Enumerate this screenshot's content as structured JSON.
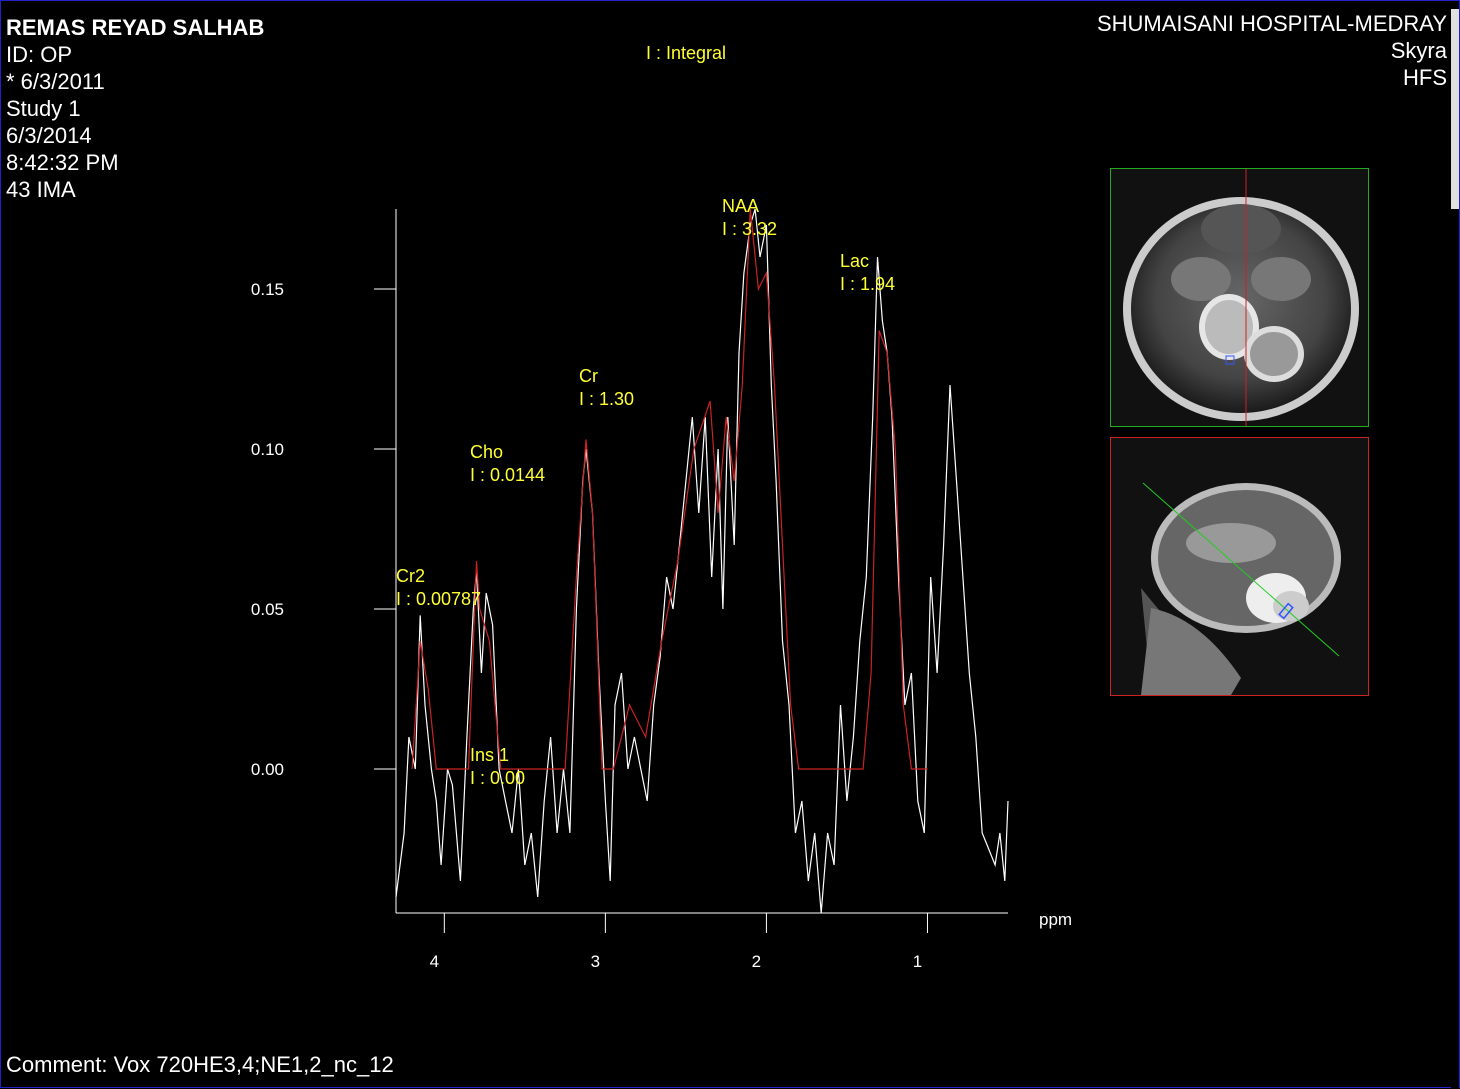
{
  "patient": {
    "name": "REMAS REYAD SALHAB",
    "id": "ID: OP",
    "birth": "* 6/3/2011",
    "study": "Study 1",
    "date": "6/3/2014",
    "time": "8:42:32 PM",
    "image": "43 IMA"
  },
  "site": {
    "hospital": "SHUMAISANI HOSPITAL-MEDRAY",
    "scanner": "Skyra",
    "position": "HFS"
  },
  "legend": "I : Integral",
  "comment": "Comment: Vox 720HE3,4;NE1,2_nc_12",
  "colors": {
    "text": "#ffffff",
    "annotation": "#ffff33",
    "fit_line": "#cc2222",
    "measured_line": "#ffffff",
    "axial_frame": "#22aa22",
    "sagittal_frame": "#cc2222",
    "border": "#2222cc"
  },
  "chart_data": {
    "type": "line",
    "xlabel": "ppm",
    "ylabel": "",
    "x_reversed": true,
    "xlim": [
      4.3,
      0.5
    ],
    "ylim": [
      -0.045,
      0.175
    ],
    "x_ticks": [
      4,
      3,
      2,
      1
    ],
    "y_ticks": [
      0.0,
      0.05,
      0.1,
      0.15
    ],
    "y_tick_labels": [
      "0.00",
      "0.05",
      "0.10",
      "0.15"
    ],
    "x_tick_labels": [
      "4",
      "3",
      "2",
      "1"
    ],
    "peaks": [
      {
        "name": "Cr2",
        "integral": "I : 0.00787",
        "ppm": 4.15,
        "height": 0.04
      },
      {
        "name": "Cho",
        "integral": "I : 0.0144",
        "ppm": 3.8,
        "height": 0.065
      },
      {
        "name": "Cr",
        "integral": "I : 1.30",
        "ppm": 3.1,
        "height": 0.103
      },
      {
        "name": "NAA",
        "integral": "I : 3.32",
        "ppm": 2.0,
        "height": 0.175
      },
      {
        "name": "Lac",
        "integral": "I : 1.94",
        "ppm": 1.3,
        "height": 0.137
      },
      {
        "name": "Ins 1",
        "integral": "I : 0.00",
        "ppm": 3.6,
        "height": 0.0
      }
    ],
    "fit_series": {
      "name": "",
      "x": [
        4.2,
        4.15,
        4.1,
        4.05,
        3.95,
        3.85,
        3.8,
        3.78,
        3.72,
        3.65,
        3.6,
        3.4,
        3.25,
        3.18,
        3.12,
        3.08,
        3.02,
        2.95,
        2.85,
        2.75,
        2.65,
        2.55,
        2.45,
        2.35,
        2.3,
        2.25,
        2.2,
        2.15,
        2.1,
        2.05,
        2.0,
        1.95,
        1.9,
        1.85,
        1.8,
        1.75,
        1.6,
        1.45,
        1.4,
        1.35,
        1.3,
        1.25,
        1.2,
        1.15,
        1.1,
        1.0
      ],
      "y": [
        0.0,
        0.04,
        0.025,
        0.0,
        0.0,
        0.0,
        0.065,
        0.05,
        0.04,
        0.0,
        0.0,
        0.0,
        0.0,
        0.06,
        0.103,
        0.08,
        0.0,
        0.0,
        0.02,
        0.01,
        0.04,
        0.065,
        0.1,
        0.115,
        0.08,
        0.11,
        0.09,
        0.12,
        0.175,
        0.15,
        0.155,
        0.12,
        0.07,
        0.02,
        0.0,
        0.0,
        0.0,
        0.0,
        0.0,
        0.03,
        0.137,
        0.13,
        0.1,
        0.02,
        0.0,
        0.0
      ]
    },
    "measured_series": {
      "name": "",
      "x": [
        4.3,
        4.25,
        4.22,
        4.18,
        4.15,
        4.12,
        4.08,
        4.05,
        4.02,
        3.98,
        3.95,
        3.9,
        3.86,
        3.82,
        3.8,
        3.77,
        3.74,
        3.7,
        3.66,
        3.62,
        3.58,
        3.54,
        3.5,
        3.46,
        3.42,
        3.38,
        3.34,
        3.3,
        3.26,
        3.22,
        3.18,
        3.14,
        3.12,
        3.08,
        3.04,
        3.0,
        2.97,
        2.94,
        2.9,
        2.86,
        2.82,
        2.78,
        2.74,
        2.7,
        2.66,
        2.62,
        2.58,
        2.54,
        2.5,
        2.46,
        2.42,
        2.38,
        2.34,
        2.3,
        2.27,
        2.24,
        2.2,
        2.17,
        2.14,
        2.1,
        2.07,
        2.04,
        2.0,
        1.97,
        1.94,
        1.9,
        1.86,
        1.82,
        1.78,
        1.74,
        1.7,
        1.66,
        1.62,
        1.58,
        1.54,
        1.5,
        1.46,
        1.42,
        1.38,
        1.34,
        1.31,
        1.28,
        1.25,
        1.22,
        1.18,
        1.14,
        1.1,
        1.06,
        1.02,
        0.98,
        0.94,
        0.9,
        0.86,
        0.82,
        0.78,
        0.74,
        0.7,
        0.66,
        0.62,
        0.58,
        0.55,
        0.52,
        0.5
      ],
      "y": [
        -0.04,
        -0.02,
        0.01,
        0.0,
        0.048,
        0.02,
        0.0,
        -0.01,
        -0.03,
        0.0,
        -0.005,
        -0.035,
        0.01,
        0.05,
        0.062,
        0.03,
        0.055,
        0.045,
        0.0,
        -0.01,
        -0.02,
        0.0,
        -0.03,
        -0.02,
        -0.04,
        -0.01,
        0.01,
        -0.02,
        0.0,
        -0.02,
        0.05,
        0.09,
        0.1,
        0.08,
        0.03,
        -0.01,
        -0.035,
        0.02,
        0.03,
        0.0,
        0.01,
        0.0,
        -0.01,
        0.02,
        0.035,
        0.06,
        0.05,
        0.07,
        0.09,
        0.11,
        0.08,
        0.11,
        0.06,
        0.1,
        0.05,
        0.11,
        0.07,
        0.13,
        0.155,
        0.17,
        0.175,
        0.16,
        0.17,
        0.12,
        0.09,
        0.04,
        0.02,
        -0.02,
        -0.01,
        -0.035,
        -0.02,
        -0.045,
        -0.02,
        -0.03,
        0.02,
        -0.01,
        0.01,
        0.04,
        0.06,
        0.11,
        0.16,
        0.14,
        0.13,
        0.11,
        0.06,
        0.02,
        0.03,
        -0.01,
        -0.02,
        0.06,
        0.03,
        0.07,
        0.12,
        0.09,
        0.06,
        0.03,
        0.01,
        -0.02,
        -0.025,
        -0.03,
        -0.02,
        -0.035,
        -0.01
      ]
    }
  }
}
